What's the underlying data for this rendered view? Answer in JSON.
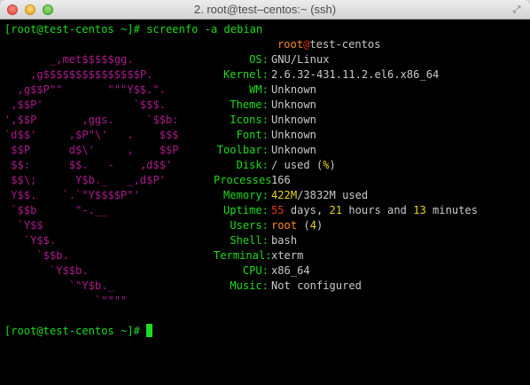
{
  "window": {
    "title": "2. root@test–centos:~ (ssh)"
  },
  "terminal": {
    "prompt1": "[root@test-centos ~]# ",
    "command": "screenfo -a debian",
    "user_host": {
      "user": "root",
      "at": "@",
      "host": "test-centos"
    },
    "logo": [
      "",
      "       _,met$$$$$gg.",
      "    ,g$$$$$$$$$$$$$$$P.",
      "  ,g$$P\"\"       \"\"\"Y$$.\".",
      " ,$$P'              `$$$.",
      "',$$P       ,ggs.     `$$b:",
      "`d$$'     ,$P\"\\'   .    $$$",
      " $$P      d$\\'     ,    $$P",
      " $$:      $$.   -    ,d$$'",
      " $$\\;      Y$b._   _,d$P'",
      " Y$$.    `.`\"Y$$$$P\"'",
      " `$$b      \"-.__",
      "  `Y$$",
      "   `Y$$.",
      "     `$$b.",
      "       `Y$$b.",
      "          `\"Y$b._",
      "              `\"\"\"\""
    ],
    "info": {
      "os": {
        "label": "OS:",
        "value": "GNU/Linux"
      },
      "kernel": {
        "label": "Kernel:",
        "value": "2.6.32-431.11.2.el6.x86_64"
      },
      "wm": {
        "label": "WM:",
        "value": "Unknown"
      },
      "theme": {
        "label": "Theme:",
        "value": "Unknown"
      },
      "icons": {
        "label": "Icons:",
        "value": "Unknown"
      },
      "font": {
        "label": "Font:",
        "value": "Unknown"
      },
      "toolbar": {
        "label": "Toolbar:",
        "value": "Unknown"
      },
      "disk": {
        "label": "Disk:",
        "value_pre": "/ used (",
        "value_pct": "%",
        "value_post": ")"
      },
      "processes": {
        "label": "Processes:",
        "value": "166"
      },
      "memory": {
        "label": "Memory:",
        "used": "422M",
        "slash": "/",
        "total": "3832M",
        "suffix": " used"
      },
      "uptime": {
        "label": "Uptime:",
        "days": "55",
        "days_label": " days, ",
        "hours": "21",
        "hours_label": " hours and ",
        "minutes": "13",
        "minutes_label": " minutes"
      },
      "users": {
        "label": "Users:",
        "name": "root",
        "paren_open": " (",
        "count": "4",
        "paren_close": ")"
      },
      "shell": {
        "label": "Shell:",
        "value": "bash"
      },
      "terminal": {
        "label": "Terminal:",
        "value": "xterm"
      },
      "cpu": {
        "label": "CPU:",
        "value": "x86_64"
      },
      "music": {
        "label": "Music:",
        "value": "Not configured"
      }
    },
    "prompt2": "[root@test-centos ~]# "
  }
}
